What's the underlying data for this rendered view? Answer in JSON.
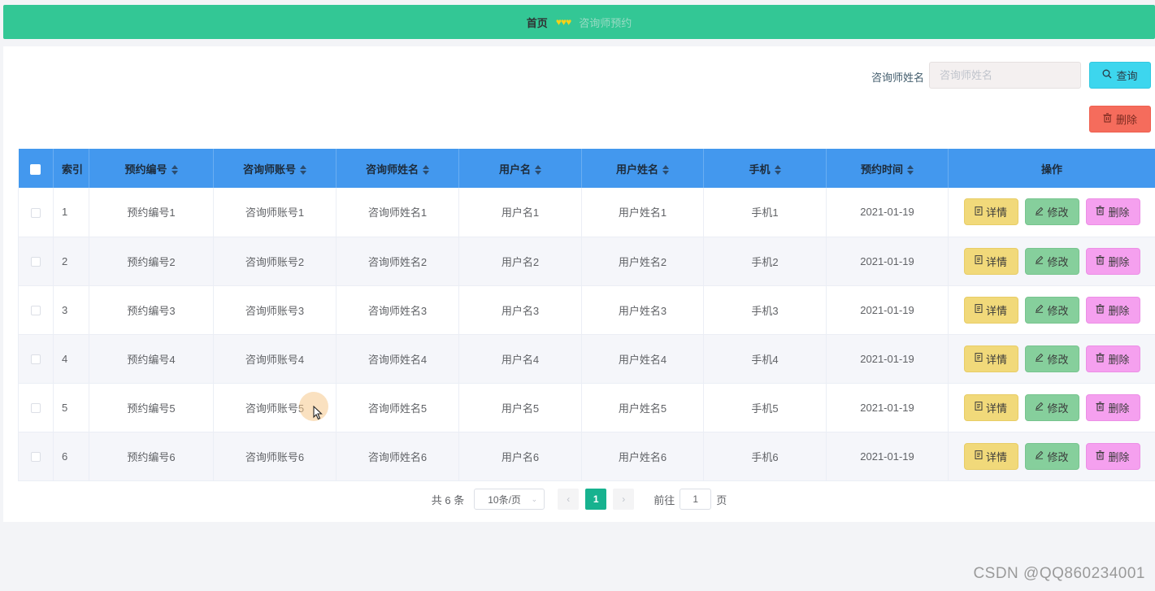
{
  "breadcrumb": {
    "home": "首页",
    "separator": "♥♥♥",
    "current": "咨询师预约"
  },
  "search": {
    "label": "咨询师姓名",
    "placeholder": "咨询师姓名",
    "query_label": "查询"
  },
  "toolbar": {
    "delete_label": "删除"
  },
  "table": {
    "headers": [
      "索引",
      "预约编号",
      "咨询师账号",
      "咨询师姓名",
      "用户名",
      "用户姓名",
      "手机",
      "预约时间",
      "操作"
    ],
    "rows": [
      [
        "1",
        "预约编号1",
        "咨询师账号1",
        "咨询师姓名1",
        "用户名1",
        "用户姓名1",
        "手机1",
        "2021-01-19"
      ],
      [
        "2",
        "预约编号2",
        "咨询师账号2",
        "咨询师姓名2",
        "用户名2",
        "用户姓名2",
        "手机2",
        "2021-01-19"
      ],
      [
        "3",
        "预约编号3",
        "咨询师账号3",
        "咨询师姓名3",
        "用户名3",
        "用户姓名3",
        "手机3",
        "2021-01-19"
      ],
      [
        "4",
        "预约编号4",
        "咨询师账号4",
        "咨询师姓名4",
        "用户名4",
        "用户姓名4",
        "手机4",
        "2021-01-19"
      ],
      [
        "5",
        "预约编号5",
        "咨询师账号5",
        "咨询师姓名5",
        "用户名5",
        "用户姓名5",
        "手机5",
        "2021-01-19"
      ],
      [
        "6",
        "预约编号6",
        "咨询师账号6",
        "咨询师姓名6",
        "用户名6",
        "用户姓名6",
        "手机6",
        "2021-01-19"
      ]
    ],
    "row_actions": {
      "detail": "详情",
      "edit": "修改",
      "delete": "删除"
    }
  },
  "pagination": {
    "total_text": "共 6 条",
    "page_size": "10条/页",
    "current_page": "1",
    "goto_prefix": "前往",
    "goto_value": "1",
    "goto_suffix": "页"
  },
  "watermark": "CSDN @QQ860234001",
  "colors": {
    "topbar": "#33c795",
    "table_header": "#4398ee",
    "query_button": "#3dd6ee",
    "delete_button": "#f56c5c",
    "detail_button": "#f1d97a",
    "edit_button": "#86cf9c",
    "row_delete_button": "#f5a0ef",
    "active_page": "#17b28f"
  },
  "icons": {
    "search": "search-icon",
    "trash": "trash-icon",
    "document": "document-icon",
    "pencil": "pencil-icon"
  }
}
